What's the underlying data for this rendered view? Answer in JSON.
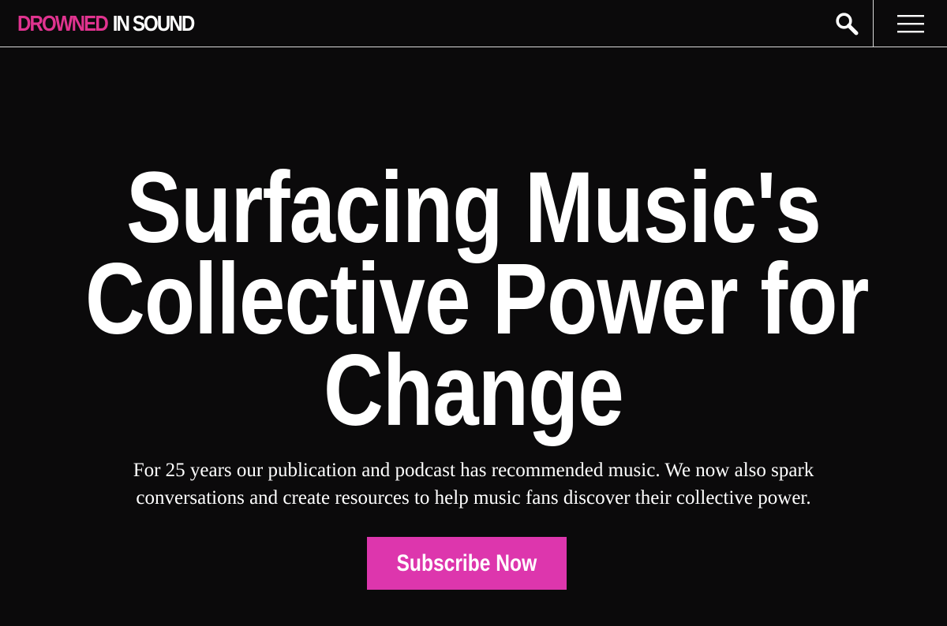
{
  "header": {
    "logo_part1": "DROWNED",
    "logo_part2": "IN SOUND",
    "search_icon": "search-icon",
    "menu_icon": "hamburger-menu-icon"
  },
  "hero": {
    "headline_lines": [
      "Surfacing Music's",
      "Collective Power for",
      "Change"
    ],
    "subtitle_lines": [
      "For 25 years our publication and podcast has recommended music. We now also spark",
      "conversations and create resources to help music fans discover their collective power."
    ],
    "cta_label": "Subscribe Now"
  },
  "colors": {
    "background": "#0b0a0b",
    "brand_pink": "#e0338f",
    "cta_pink": "#dd36ad",
    "text": "#ffffff"
  }
}
